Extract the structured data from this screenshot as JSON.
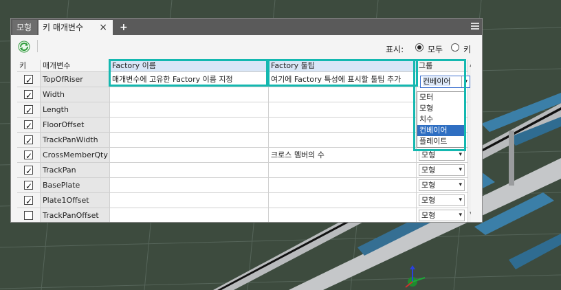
{
  "tabs": {
    "model": "모형",
    "params": "키 매개변수",
    "close": "×",
    "add": "+"
  },
  "toolbar": {
    "display_label": "표시:",
    "radio_all": "모두",
    "radio_key": "키"
  },
  "columns": {
    "key": "키",
    "param": "매개변수",
    "factory_name": "Factory 이름",
    "factory_tooltip": "Factory 툴팁",
    "group": "그룹"
  },
  "rows": [
    {
      "checked": true,
      "name": "TopOfRiser",
      "factory_name": "매개변수에 고유한 Factory 이름 지정",
      "tooltip": "여기에  Factory 특성에 표시할 툴팁 추가",
      "group": ""
    },
    {
      "checked": true,
      "name": "Width",
      "factory_name": "",
      "tooltip": "",
      "group": ""
    },
    {
      "checked": true,
      "name": "Length",
      "factory_name": "",
      "tooltip": "",
      "group": ""
    },
    {
      "checked": true,
      "name": "FloorOffset",
      "factory_name": "",
      "tooltip": "",
      "group": ""
    },
    {
      "checked": true,
      "name": "TrackPanWidth",
      "factory_name": "",
      "tooltip": "",
      "group": ""
    },
    {
      "checked": true,
      "name": "CrossMemberQty",
      "factory_name": "",
      "tooltip": "크로스 멤버의 수",
      "group": "모형"
    },
    {
      "checked": true,
      "name": "TrackPan",
      "factory_name": "",
      "tooltip": "",
      "group": "모형"
    },
    {
      "checked": true,
      "name": "BasePlate",
      "factory_name": "",
      "tooltip": "",
      "group": "모형"
    },
    {
      "checked": true,
      "name": "Plate1Offset",
      "factory_name": "",
      "tooltip": "",
      "group": "모형"
    },
    {
      "checked": false,
      "name": "TrackPanOffset",
      "factory_name": "",
      "tooltip": "",
      "group": "모형"
    }
  ],
  "group_dropdown": {
    "selected": "컨베이어",
    "options": [
      "모터",
      "모형",
      "치수",
      "컨베이어",
      "플레이트"
    ],
    "active_index": 3
  },
  "colors": {
    "highlight": "#14b8b0",
    "tabbar": "#5a5a5a",
    "selection": "#2f6fc2"
  }
}
